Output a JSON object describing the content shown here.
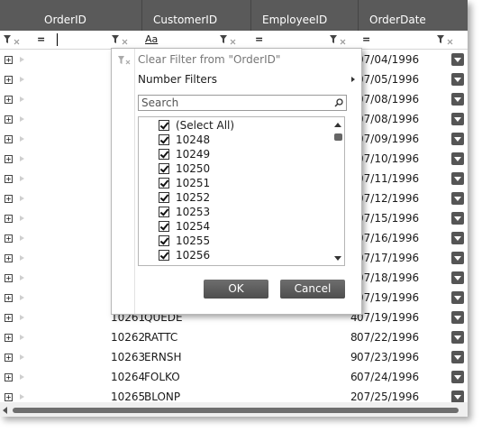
{
  "columns": [
    "OrderID",
    "CustomerID",
    "EmployeeID",
    "OrderDate"
  ],
  "filter_row": {
    "orderid_op": "=",
    "customerid_op": "Aa",
    "employeeid_op": "=",
    "orderdate_op": "="
  },
  "rows": [
    {
      "order_id": "",
      "customer_id": "",
      "employee_id": "",
      "order_date": "07/04/1996"
    },
    {
      "order_id": "",
      "customer_id": "",
      "employee_id": "",
      "order_date": "07/05/1996"
    },
    {
      "order_id": "",
      "customer_id": "",
      "employee_id": "",
      "order_date": "07/08/1996"
    },
    {
      "order_id": "",
      "customer_id": "",
      "employee_id": "",
      "order_date": "07/08/1996"
    },
    {
      "order_id": "",
      "customer_id": "",
      "employee_id": "",
      "order_date": "07/09/1996"
    },
    {
      "order_id": "",
      "customer_id": "",
      "employee_id": "",
      "order_date": "07/10/1996"
    },
    {
      "order_id": "",
      "customer_id": "",
      "employee_id": "",
      "order_date": "07/11/1996"
    },
    {
      "order_id": "",
      "customer_id": "",
      "employee_id": "",
      "order_date": "07/12/1996"
    },
    {
      "order_id": "",
      "customer_id": "",
      "employee_id": "",
      "order_date": "07/15/1996"
    },
    {
      "order_id": "",
      "customer_id": "",
      "employee_id": "",
      "order_date": "07/16/1996"
    },
    {
      "order_id": "",
      "customer_id": "",
      "employee_id": "",
      "order_date": "07/17/1996"
    },
    {
      "order_id": "",
      "customer_id": "",
      "employee_id": "",
      "order_date": "07/18/1996"
    },
    {
      "order_id": "",
      "customer_id": "",
      "employee_id": "",
      "order_date": "07/19/1996"
    },
    {
      "order_id": "10261",
      "customer_id": "QUEDE",
      "employee_id": "4",
      "order_date": "07/19/1996"
    },
    {
      "order_id": "10262",
      "customer_id": "RATTC",
      "employee_id": "8",
      "order_date": "07/22/1996"
    },
    {
      "order_id": "10263",
      "customer_id": "ERNSH",
      "employee_id": "9",
      "order_date": "07/23/1996"
    },
    {
      "order_id": "10264",
      "customer_id": "FOLKO",
      "employee_id": "6",
      "order_date": "07/24/1996"
    },
    {
      "order_id": "10265",
      "customer_id": "BLONP",
      "employee_id": "2",
      "order_date": "07/25/1996"
    }
  ],
  "filter_popup": {
    "clear_filter": "Clear Filter from \"OrderID\"",
    "number_filters": "Number Filters",
    "search_placeholder": "Search",
    "items": [
      "(Select All)",
      "10248",
      "10249",
      "10250",
      "10251",
      "10252",
      "10253",
      "10254",
      "10255",
      "10256"
    ],
    "ok_label": "OK",
    "cancel_label": "Cancel"
  }
}
